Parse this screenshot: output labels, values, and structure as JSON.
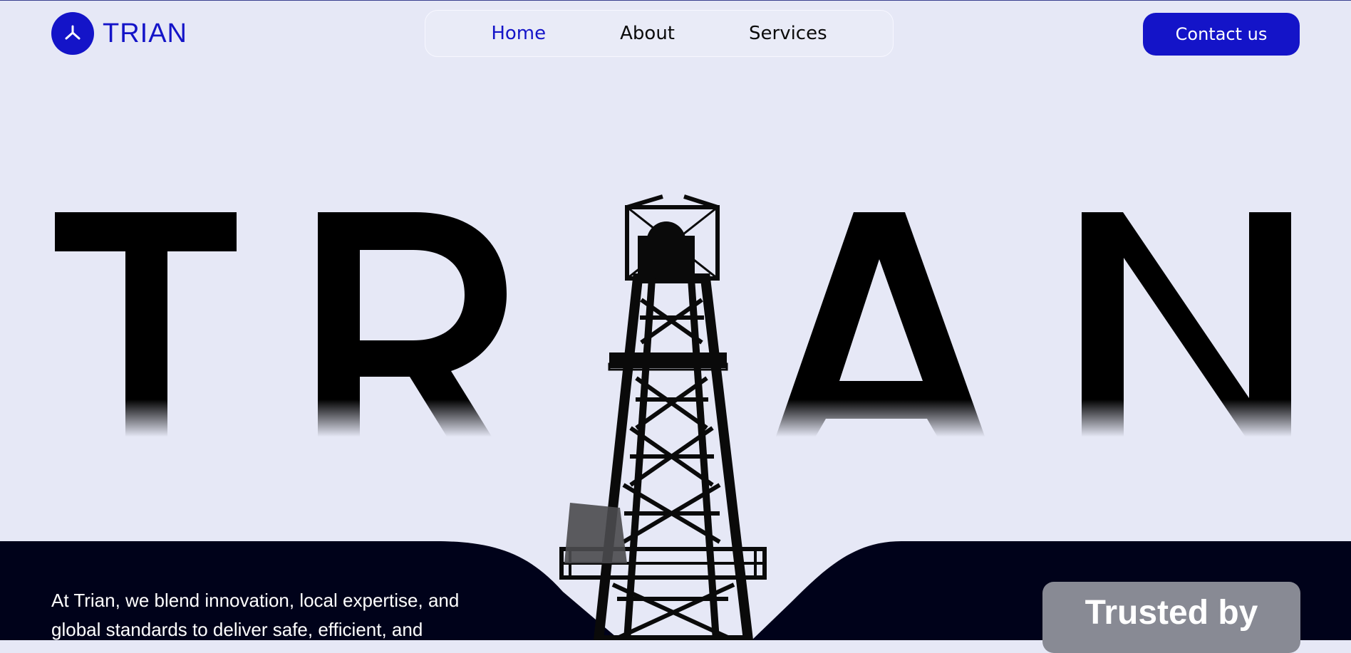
{
  "brand": {
    "name": "TRIAN",
    "accent": "#1414c8"
  },
  "nav": {
    "items": [
      {
        "label": "Home",
        "active": true
      },
      {
        "label": "About",
        "active": false
      },
      {
        "label": "Services",
        "active": false
      }
    ]
  },
  "header": {
    "contact_label": "Contact us"
  },
  "hero": {
    "letters": [
      "T",
      "R",
      "I",
      "A",
      "N"
    ],
    "image": "oil-rig-tower-silhouette"
  },
  "intro": {
    "line1": "At Trian, we blend innovation, local expertise, and",
    "line2": "global standards to deliver safe, efficient, and"
  },
  "trusted": {
    "title": "Trusted by"
  },
  "colors": {
    "background": "#e6e8f6",
    "dark_band": "#00021a",
    "text_dark": "#0b0b0b"
  }
}
